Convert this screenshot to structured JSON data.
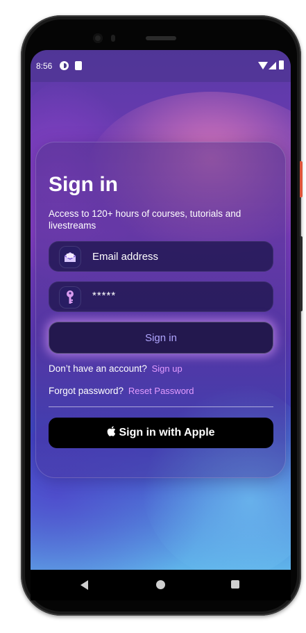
{
  "status_bar": {
    "time": "8:56"
  },
  "signin": {
    "title": "Sign in",
    "subtitle": "Access to 120+ hours of courses, tutorials and livestreams",
    "email_placeholder": "Email address",
    "password_value": "*****",
    "signin_label": "Sign in",
    "no_account_text": "Don’t have an account?",
    "signup_link": "Sign up",
    "forgot_text": "Forgot password?",
    "reset_link": "Reset Password",
    "apple_label": "Sign in with Apple"
  },
  "colors": {
    "accent_link": "#e29bff",
    "button_text": "#b0a6ff",
    "field_bg": "#231955"
  },
  "icons": {
    "email": "envelope-icon",
    "password": "key-icon",
    "apple": "apple-icon",
    "nav_back": "back-triangle-icon",
    "nav_home": "home-circle-icon",
    "nav_recent": "recent-square-icon"
  }
}
